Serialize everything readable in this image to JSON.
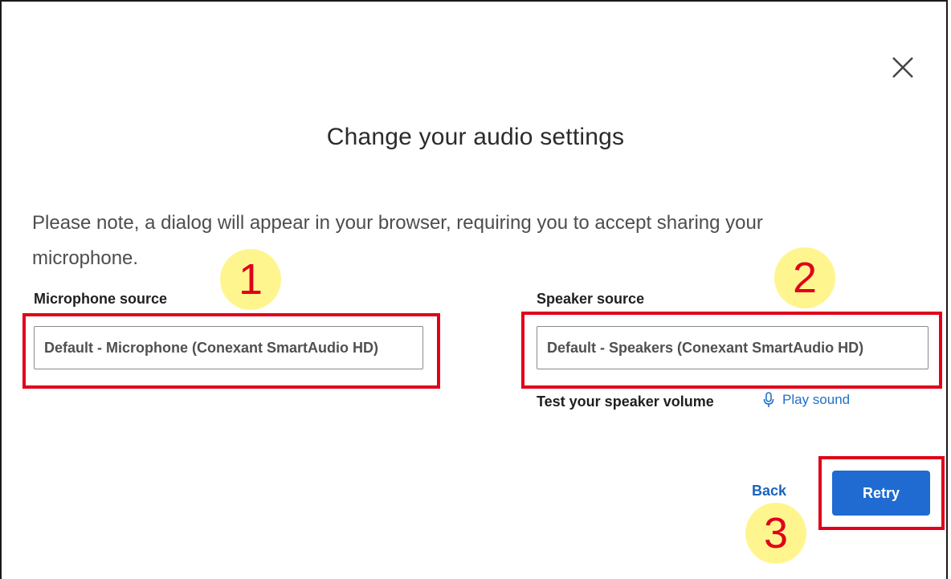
{
  "dialog": {
    "title": "Change your audio settings",
    "note": "Please note, a dialog will appear in your browser, requiring you to accept sharing your microphone."
  },
  "microphone": {
    "label": "Microphone source",
    "value": "Default - Microphone (Conexant SmartAudio HD)"
  },
  "speaker": {
    "label": "Speaker source",
    "value": "Default - Speakers (Conexant SmartAudio HD)",
    "test_label": "Test your speaker volume",
    "play_label": "Play sound"
  },
  "actions": {
    "back_label": "Back",
    "retry_label": "Retry"
  },
  "annotations": {
    "marker_1": "1",
    "marker_2": "2",
    "marker_3": "3"
  },
  "icons": {
    "close": "close-icon",
    "play": "microphone-icon"
  },
  "colors": {
    "accent": "#1f6bd1",
    "link": "#2170c9",
    "highlight": "#e0001a",
    "marker_fill": "#fff58f"
  }
}
